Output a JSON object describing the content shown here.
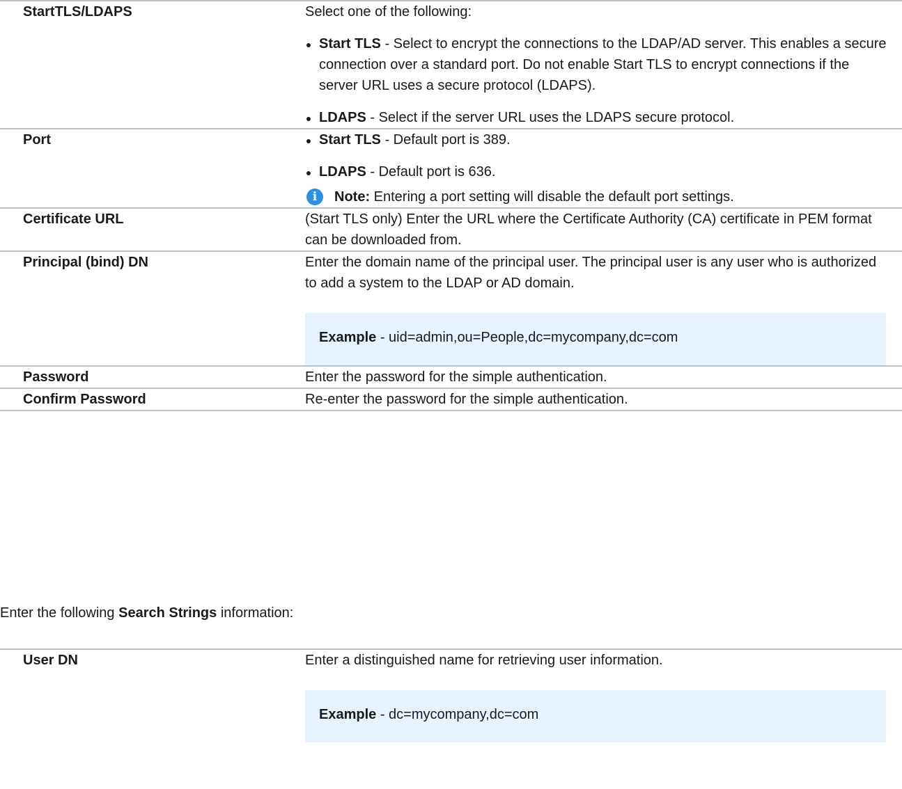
{
  "table1": {
    "rows": {
      "starttls": {
        "name": "StartTLS/LDAPS",
        "intro": "Select one of the following:",
        "b1_term": "Start TLS",
        "b1_text": " - Select to encrypt the connections to the LDAP/AD server. This enables a secure connection over a standard port. Do not enable Start TLS to encrypt connections if the server URL uses a secure protocol (LDAPS).",
        "b2_term": "LDAPS",
        "b2_text": " - Select if the server URL uses the LDAPS secure protocol."
      },
      "port": {
        "name": "Port",
        "b1_term": "Start TLS",
        "b1_text": " - Default port is 389.",
        "b2_term": "LDAPS",
        "b2_text": " - Default port is 636.",
        "note_label": "Note:",
        "note_text": " Entering a port setting will disable the default port settings."
      },
      "cert": {
        "name": "Certificate URL",
        "desc": "(Start TLS only) Enter the URL where the Certificate Authority (CA) certificate in PEM format can be downloaded from."
      },
      "principal": {
        "name": "Principal (bind) DN",
        "desc": "Enter the domain name of the principal user. The principal user is any user who is authorized to add a system to the LDAP or AD domain.",
        "example_label": "Example",
        "example_text": " - uid=admin,ou=People,dc=mycompany,dc=com"
      },
      "password": {
        "name": "Password",
        "desc": "Enter the password for the simple authentication."
      },
      "confirm": {
        "name": "Confirm Password",
        "desc": "Re-enter the password for the simple authentication."
      }
    }
  },
  "intro": {
    "prefix": "Enter the following ",
    "bold": "Search Strings",
    "suffix": " information:"
  },
  "table2": {
    "rows": {
      "userdn": {
        "name": "User DN",
        "desc": "Enter a distinguished name for retrieving user information.",
        "example_label": "Example",
        "example_text": " - dc=mycompany,dc=com"
      }
    }
  }
}
